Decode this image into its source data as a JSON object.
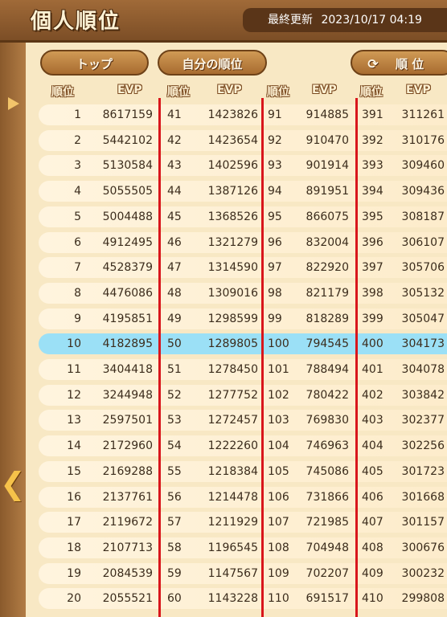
{
  "header": {
    "title": "個人順位",
    "updated_label": "最終更新",
    "updated_value": "2023/10/17 04:19"
  },
  "buttons": {
    "top": "トップ",
    "self_rank": "自分の順位",
    "rank": "順 位"
  },
  "columns": {
    "rank": "順位",
    "evp": "EVP"
  },
  "highlight_row_index": 9,
  "groups": [
    {
      "ranks": [
        "1",
        "2",
        "3",
        "4",
        "5",
        "6",
        "7",
        "8",
        "9",
        "10",
        "11",
        "12",
        "13",
        "14",
        "15",
        "16",
        "17",
        "18",
        "19",
        "20"
      ],
      "evps": [
        "8617159",
        "5442102",
        "5130584",
        "5055505",
        "5004488",
        "4912495",
        "4528379",
        "4476086",
        "4195851",
        "4182895",
        "3404418",
        "3244948",
        "2597501",
        "2172960",
        "2169288",
        "2137761",
        "2119672",
        "2107713",
        "2084539",
        "2055521"
      ]
    },
    {
      "ranks": [
        "41",
        "42",
        "43",
        "44",
        "45",
        "46",
        "47",
        "48",
        "49",
        "50",
        "51",
        "52",
        "53",
        "54",
        "55",
        "56",
        "57",
        "58",
        "59",
        "60"
      ],
      "evps": [
        "1423826",
        "1423654",
        "1402596",
        "1387126",
        "1368526",
        "1321279",
        "1314590",
        "1309016",
        "1298599",
        "1289805",
        "1278450",
        "1277752",
        "1272457",
        "1222260",
        "1218384",
        "1214478",
        "1211929",
        "1196545",
        "1147567",
        "1143228"
      ]
    },
    {
      "ranks": [
        "91",
        "92",
        "93",
        "94",
        "95",
        "96",
        "97",
        "98",
        "99",
        "100",
        "101",
        "102",
        "103",
        "104",
        "105",
        "106",
        "107",
        "108",
        "109",
        "110"
      ],
      "evps": [
        "914885",
        "910470",
        "901914",
        "891951",
        "866075",
        "832004",
        "822920",
        "821179",
        "818289",
        "794545",
        "788494",
        "780422",
        "769830",
        "746963",
        "745086",
        "731866",
        "721985",
        "704948",
        "702207",
        "691517"
      ]
    },
    {
      "ranks": [
        "391",
        "392",
        "393",
        "394",
        "395",
        "396",
        "397",
        "398",
        "399",
        "400",
        "401",
        "402",
        "403",
        "404",
        "405",
        "406",
        "407",
        "408",
        "409",
        "410"
      ],
      "evps": [
        "311261",
        "310176",
        "309460",
        "309436",
        "308187",
        "306107",
        "305706",
        "305132",
        "305047",
        "304173",
        "304078",
        "303842",
        "302377",
        "302256",
        "301723",
        "301668",
        "301157",
        "300676",
        "300232",
        "299808"
      ]
    }
  ]
}
